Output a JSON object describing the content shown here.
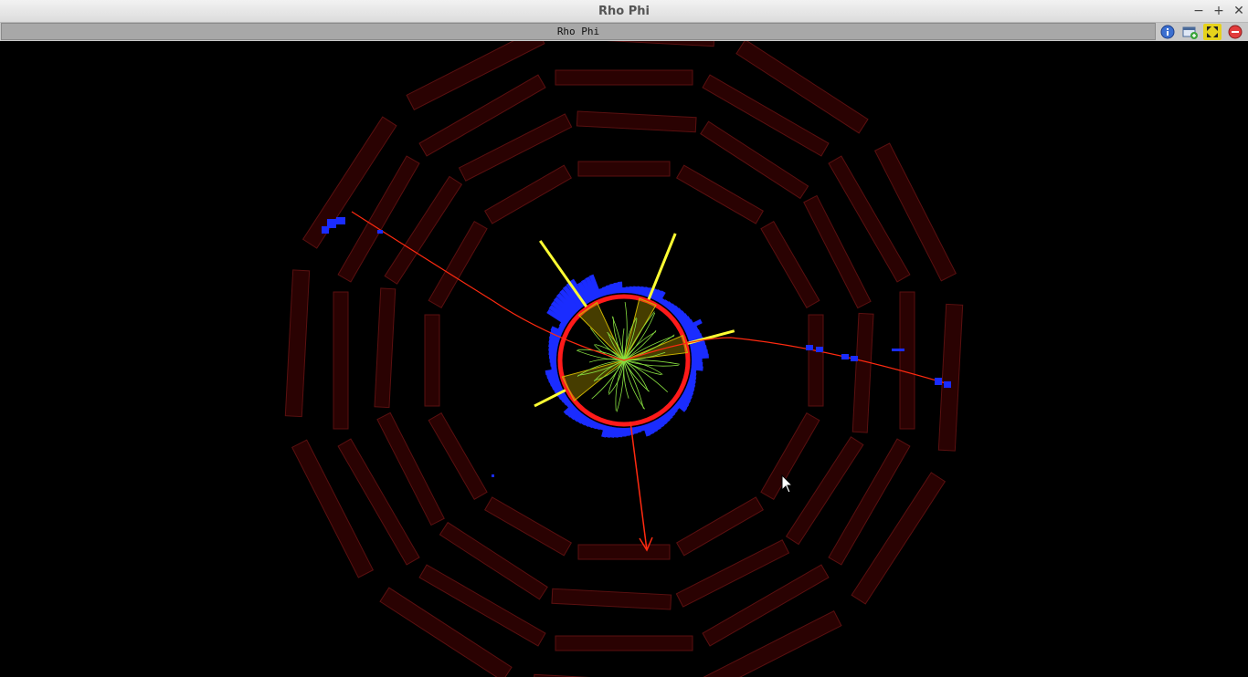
{
  "window": {
    "title": "Rho Phi",
    "controls": {
      "minimize": "−",
      "maximize": "+",
      "close": "✕"
    }
  },
  "view": {
    "tab_label": "Rho Phi",
    "buttons": [
      "info-icon",
      "add-view-icon",
      "maximize-view-icon",
      "close-view-icon"
    ]
  },
  "colors": {
    "background": "#000000",
    "detector_module": "#2a0202",
    "detector_edge": "#5a1010",
    "calorimeter_em": "#ff1a1a",
    "calorimeter_had": "#1a2cff",
    "jet": "#ffff33",
    "muon_track": "#ff2a10",
    "tracks": "#88e040"
  }
}
